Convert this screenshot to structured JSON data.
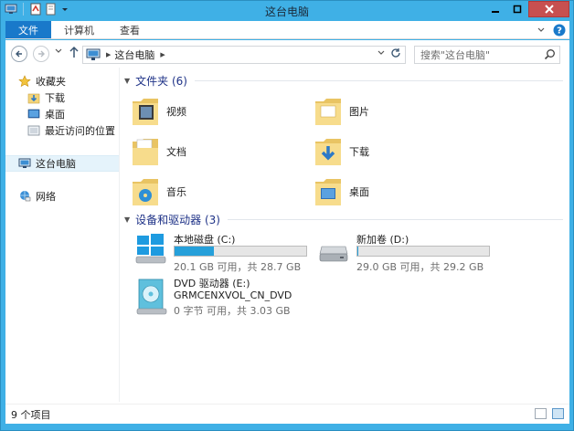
{
  "window": {
    "title": "这台电脑"
  },
  "ribbon": {
    "tabs": [
      "文件",
      "计算机",
      "查看"
    ],
    "help_label": "?"
  },
  "address_bar": {
    "location": "这台电脑",
    "search_placeholder": "搜索\"这台电脑\""
  },
  "nav_pane": {
    "favorites_label": "收藏夹",
    "favorites": [
      "下载",
      "桌面",
      "最近访问的位置"
    ],
    "this_pc_label": "这台电脑",
    "network_label": "网络"
  },
  "folders": {
    "header": "文件夹 (6)",
    "items": [
      "视频",
      "图片",
      "文档",
      "下载",
      "音乐",
      "桌面"
    ]
  },
  "drives": {
    "header": "设备和驱动器 (3)",
    "items": [
      {
        "name": "本地磁盘 (C:)",
        "free": "20.1 GB 可用，共 28.7 GB",
        "used_fraction": 0.3
      },
      {
        "name": "新加卷 (D:)",
        "free": "29.0 GB 可用，共 29.2 GB",
        "used_fraction": 0.007
      }
    ],
    "dvd": {
      "name": "DVD 驱动器 (E:)",
      "label": "GRMCENXVOL_CN_DVD",
      "free": "0 字节 可用，共 3.03 GB"
    }
  },
  "status": {
    "item_count": "9 个项目"
  },
  "colors": {
    "title_bar": "#3fb0e6",
    "file_tab": "#1979ca",
    "group_header": "#1e3287",
    "drive_fill": "#26a0da",
    "close_button": "#c75050"
  },
  "icons": [
    "computer-icon",
    "folder-icon",
    "star-icon",
    "network-icon",
    "windows-drive-icon",
    "hdd-icon",
    "dvd-icon",
    "search-icon",
    "refresh-icon",
    "back-icon",
    "forward-icon",
    "up-icon"
  ]
}
